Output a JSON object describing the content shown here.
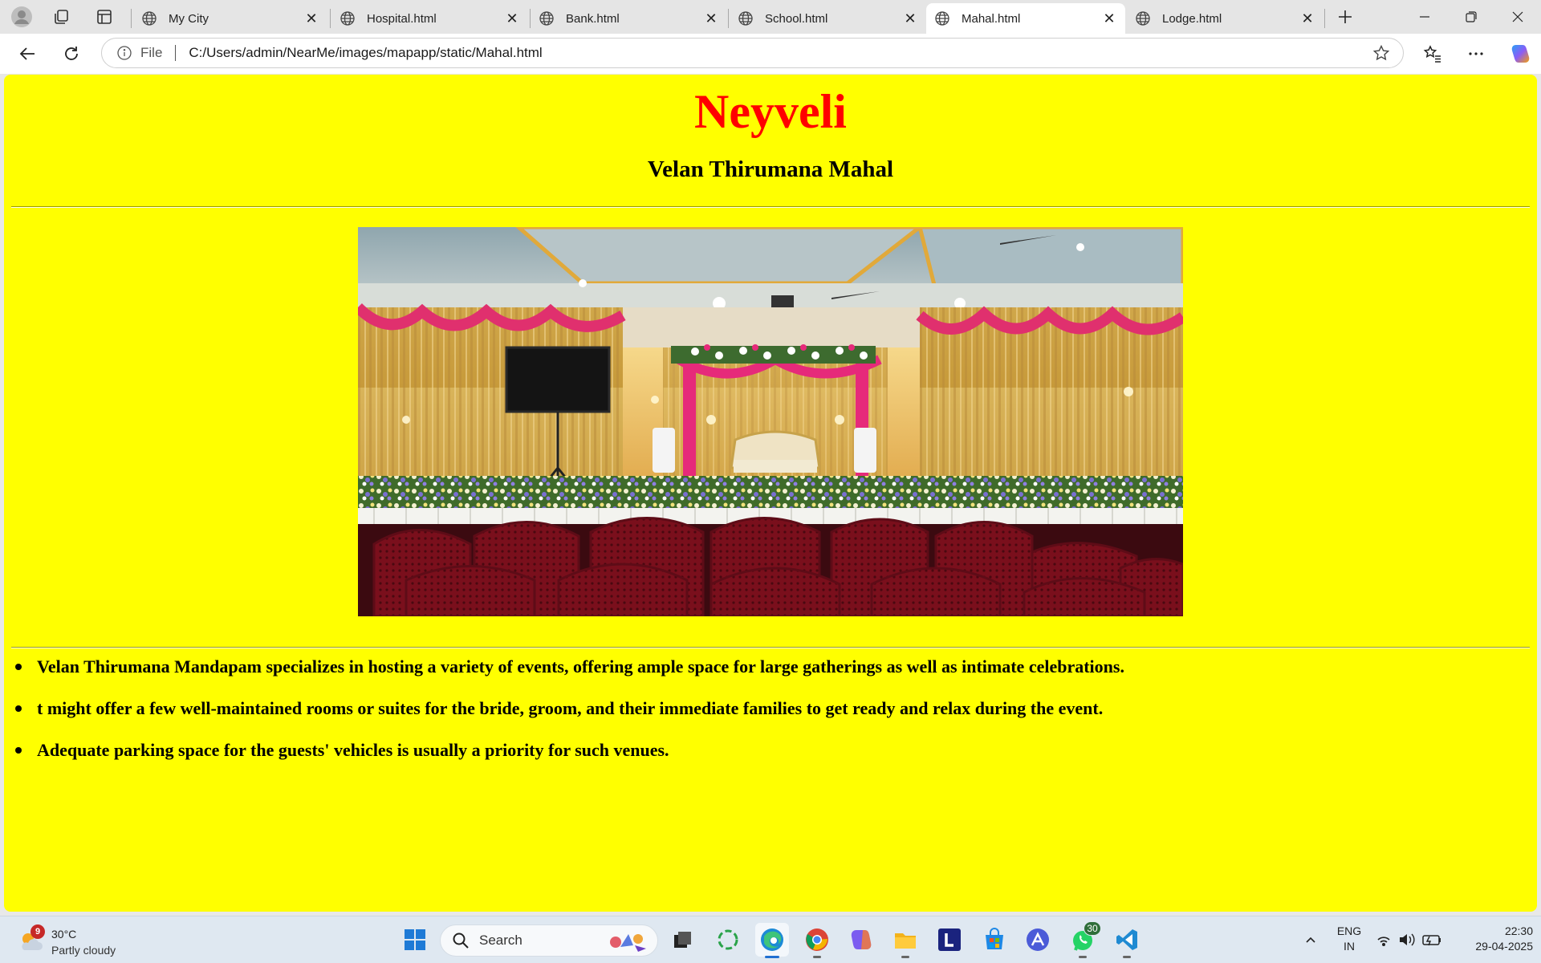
{
  "browser": {
    "tabs": [
      {
        "label": "My City",
        "active": false
      },
      {
        "label": "Hospital.html",
        "active": false
      },
      {
        "label": "Bank.html",
        "active": false
      },
      {
        "label": "School.html",
        "active": false
      },
      {
        "label": "Mahal.html",
        "active": true
      },
      {
        "label": "Lodge.html",
        "active": false
      }
    ],
    "address": {
      "scheme_label": "File",
      "url": "C:/Users/admin/NearMe/images/mapapp/static/Mahal.html"
    }
  },
  "page": {
    "background": "#ffff00",
    "heading": "Neyveli",
    "heading_color": "#ff0000",
    "subheading": "Velan Thirumana Mahal",
    "bullets": [
      "Velan Thirumana Mandapam specializes in hosting a variety of events, offering ample space for large gatherings as well as intimate celebrations.",
      "t might offer a few well-maintained rooms or suites for the bride, groom, and their immediate families to get ready and relax during the event.",
      "Adequate parking space for the guests' vehicles is usually a priority for such venues."
    ]
  },
  "taskbar": {
    "weather": {
      "badge": "9",
      "temperature": "30°C",
      "condition": "Partly cloudy"
    },
    "search_label": "Search",
    "whatsapp_badge": "30",
    "language": {
      "line1": "ENG",
      "line2": "IN"
    },
    "clock": {
      "time": "22:30",
      "date": "29-04-2025"
    },
    "icons": [
      "windows-start-icon",
      "search-icon",
      "task-view-icon",
      "copilot-icon",
      "edge-icon",
      "chrome-icon",
      "microsoft-copilot-icon",
      "file-explorer-icon",
      "l-app-icon",
      "microsoft-store-icon",
      "arc-icon",
      "whatsapp-icon",
      "vscode-icon"
    ]
  }
}
